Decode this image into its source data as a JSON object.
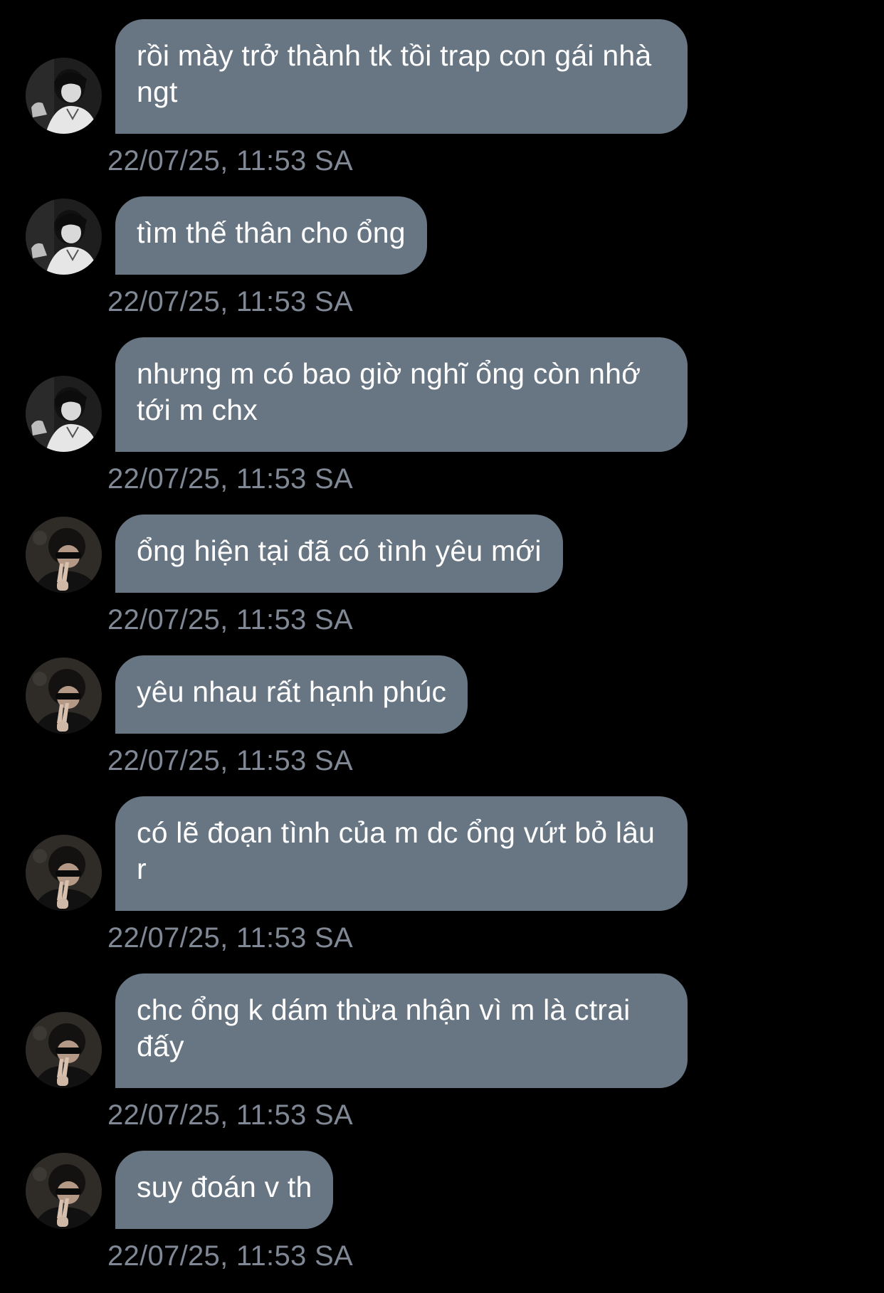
{
  "messages": [
    {
      "text": "rồi mày trở thành tk tồi trap con gái nhà ngt",
      "time": "22/07/25, 11:53 SA",
      "avatar": "avatar-1-icon"
    },
    {
      "text": "tìm thế thân cho ổng",
      "time": "22/07/25, 11:53 SA",
      "avatar": "avatar-1-icon"
    },
    {
      "text": "nhưng m có bao giờ nghĩ ổng còn nhớ tới m chx",
      "time": "22/07/25, 11:53 SA",
      "avatar": "avatar-1-icon"
    },
    {
      "text": "ổng hiện tại đã có tình yêu mới",
      "time": "22/07/25, 11:53 SA",
      "avatar": "avatar-2-icon"
    },
    {
      "text": "yêu nhau rất hạnh phúc",
      "time": "22/07/25, 11:53 SA",
      "avatar": "avatar-2-icon"
    },
    {
      "text": "có lẽ đoạn tình của m dc ổng vứt bỏ lâu r",
      "time": "22/07/25, 11:53 SA",
      "avatar": "avatar-2-icon"
    },
    {
      "text": "chc ổng k dám thừa nhận vì m là ctrai đấy",
      "time": "22/07/25, 11:53 SA",
      "avatar": "avatar-2-icon"
    },
    {
      "text": "suy đoán v th",
      "time": "22/07/25, 11:53 SA",
      "avatar": "avatar-2-icon"
    }
  ],
  "colors": {
    "background": "#000000",
    "bubble": "#687583",
    "timestamp": "#7f8894",
    "text": "#ffffff"
  }
}
